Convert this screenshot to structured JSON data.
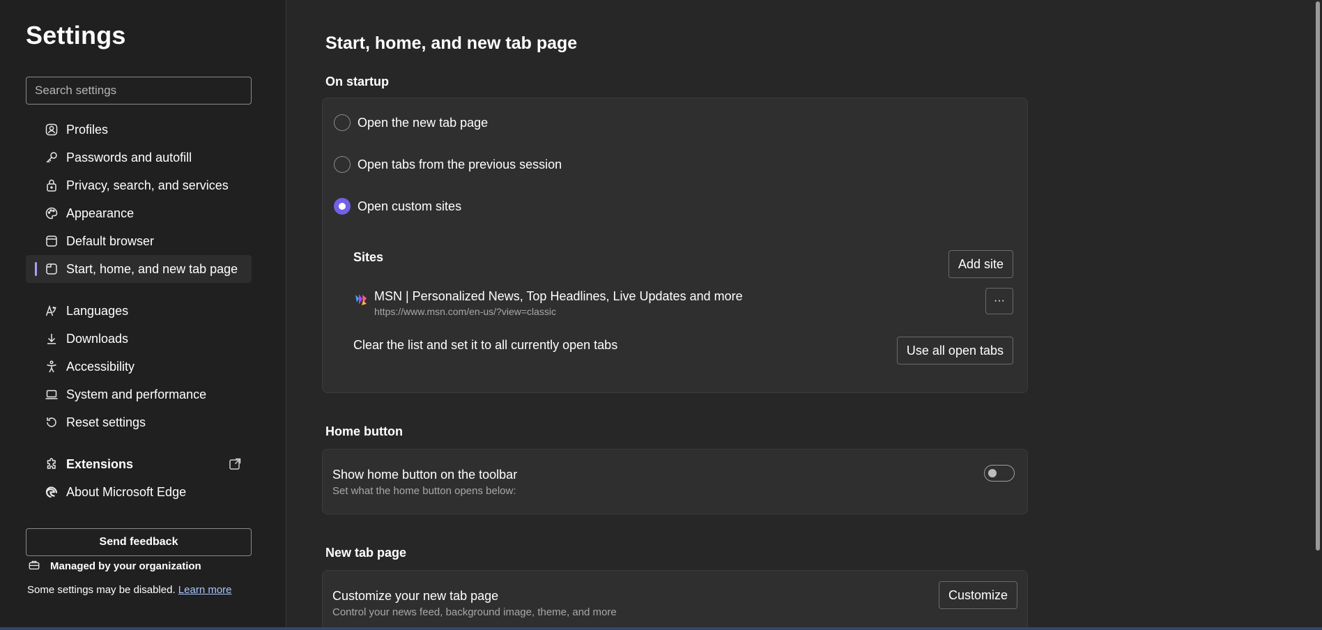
{
  "sidebar": {
    "title": "Settings",
    "search_placeholder": "Search settings",
    "items": [
      {
        "label": "Profiles"
      },
      {
        "label": "Passwords and autofill"
      },
      {
        "label": "Privacy, search, and services"
      },
      {
        "label": "Appearance"
      },
      {
        "label": "Default browser"
      },
      {
        "label": "Start, home, and new tab page"
      },
      {
        "label": "Languages"
      },
      {
        "label": "Downloads"
      },
      {
        "label": "Accessibility"
      },
      {
        "label": "System and performance"
      },
      {
        "label": "Reset settings"
      },
      {
        "label": "Extensions"
      },
      {
        "label": "About Microsoft Edge"
      }
    ],
    "active_item": "Start, home, and new tab page",
    "feedback_label": "Send feedback",
    "managed_label": "Managed by your organization",
    "disabled_note": "Some settings may be disabled.",
    "learn_more": "Learn more"
  },
  "main": {
    "page_title": "Start, home, and new tab page",
    "startup": {
      "title": "On startup",
      "options": [
        {
          "label": "Open the new tab page",
          "checked": false
        },
        {
          "label": "Open tabs from the previous session",
          "checked": false
        },
        {
          "label": "Open custom sites",
          "checked": true
        }
      ],
      "sites_label": "Sites",
      "add_site_label": "Add site",
      "site": {
        "name": "MSN | Personalized News, Top Headlines, Live Updates and more",
        "url": "https://www.msn.com/en-us/?view=classic"
      },
      "more_label": "···",
      "clear_text": "Clear the list and set it to all currently open tabs",
      "use_all_label": "Use all open tabs"
    },
    "home_button": {
      "title": "Home button",
      "row_title": "Show home button on the toolbar",
      "row_sub": "Set what the home button opens below:",
      "enabled": false
    },
    "new_tab": {
      "title": "New tab page",
      "row_title": "Customize your new tab page",
      "row_sub": "Control your news feed, background image, theme, and more",
      "customize_label": "Customize"
    }
  },
  "colors": {
    "accent": "#7160e8",
    "active_indicator": "#a9a3f5",
    "link": "#a9c7ff",
    "background": "#272727",
    "sidebar_background": "#202020",
    "card_background": "#2f2f2f"
  },
  "icons": {
    "profiles": "profile-icon",
    "passwords": "key-icon",
    "privacy": "lock-icon",
    "appearance": "palette-icon",
    "default_browser": "browser-icon",
    "start_home": "window-icon",
    "languages": "language-icon",
    "downloads": "download-icon",
    "accessibility": "accessibility-icon",
    "system": "laptop-icon",
    "reset": "reset-icon",
    "extensions": "puzzle-icon",
    "about": "edge-logo-icon",
    "external_link": "external-link-icon",
    "managed": "briefcase-icon"
  }
}
